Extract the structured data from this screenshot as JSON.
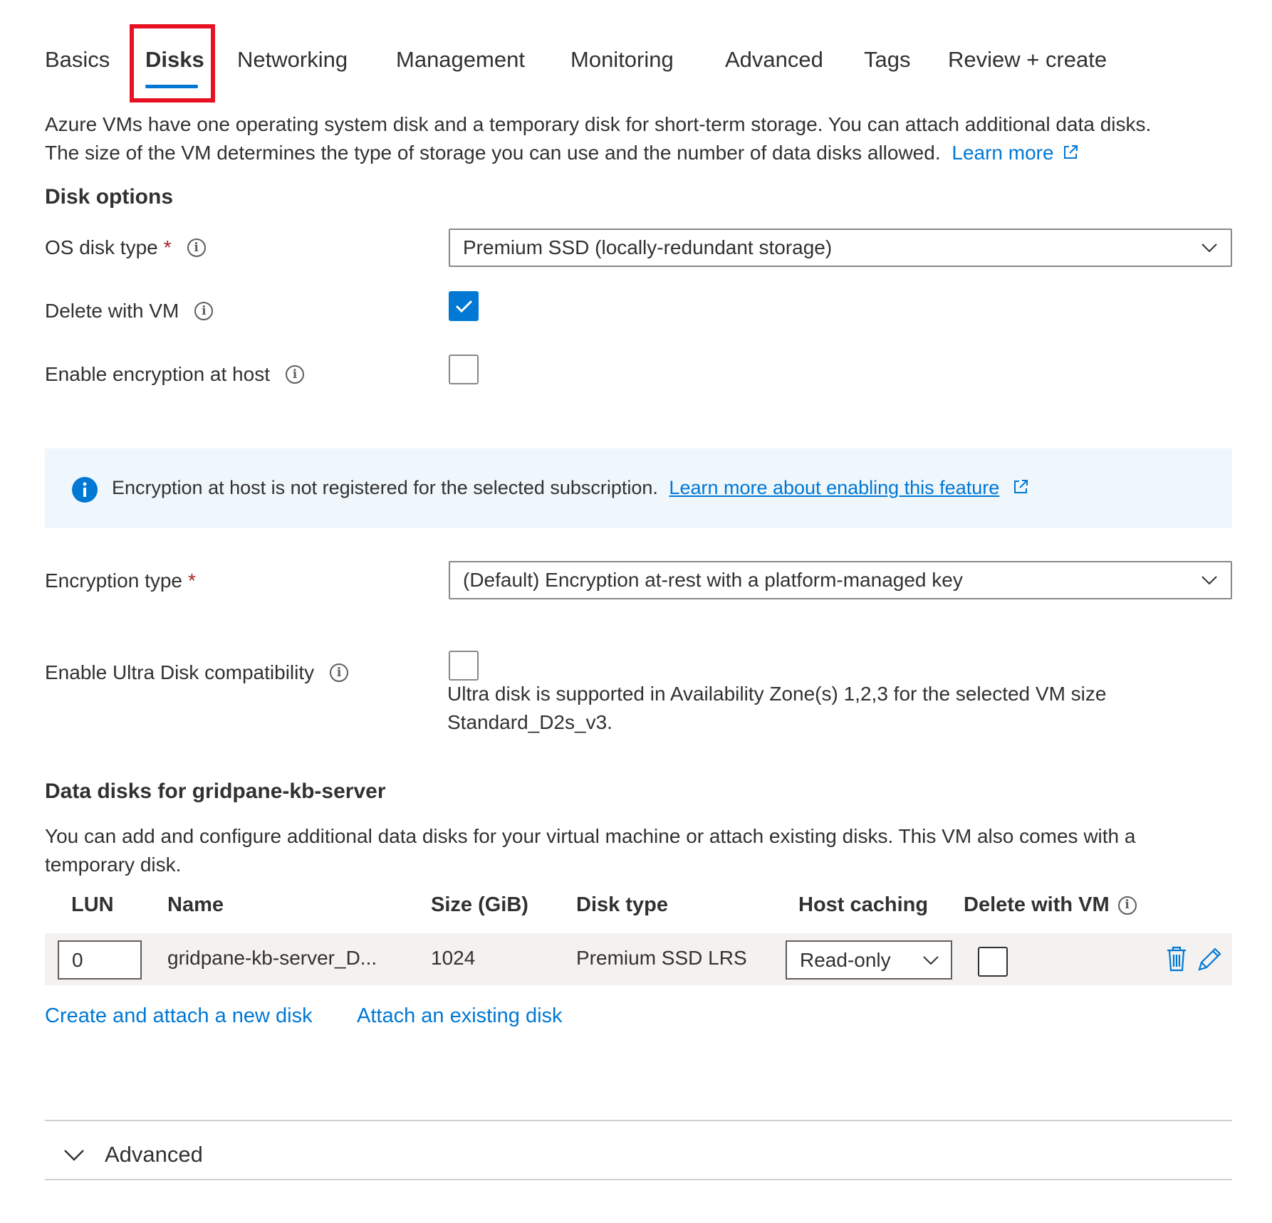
{
  "tabs": [
    {
      "label": "Basics"
    },
    {
      "label": "Disks",
      "active": true
    },
    {
      "label": "Networking"
    },
    {
      "label": "Management"
    },
    {
      "label": "Monitoring"
    },
    {
      "label": "Advanced"
    },
    {
      "label": "Tags"
    },
    {
      "label": "Review + create"
    }
  ],
  "intro": {
    "line1": "Azure VMs have one operating system disk and a temporary disk for short-term storage. You can attach additional data disks.",
    "line2": "The size of the VM determines the type of storage you can use and the number of data disks allowed.",
    "learn_more": "Learn more"
  },
  "disk_options": {
    "title": "Disk options",
    "os_disk_type": {
      "label": "OS disk type",
      "required": "*",
      "value": "Premium SSD (locally-redundant storage)"
    },
    "delete_with_vm": {
      "label": "Delete with VM",
      "checked": true
    },
    "encryption_at_host": {
      "label": "Enable encryption at host",
      "checked": false
    }
  },
  "banner": {
    "text": "Encryption at host is not registered for the selected subscription.",
    "link": "Learn more about enabling this feature"
  },
  "encryption_type": {
    "label": "Encryption type",
    "required": "*",
    "value": "(Default) Encryption at-rest with a platform-managed key"
  },
  "ultra_disk": {
    "label": "Enable Ultra Disk compatibility",
    "checked": false,
    "note_line1": "Ultra disk is supported in Availability Zone(s) 1,2,3 for the selected VM size",
    "note_line2": "Standard_D2s_v3."
  },
  "data_disks": {
    "title": "Data disks for gridpane-kb-server",
    "desc_line1": "You can add and configure additional data disks for your virtual machine or attach existing disks. This VM also comes with a",
    "desc_line2": "temporary disk.",
    "columns": {
      "lun": "LUN",
      "name": "Name",
      "size": "Size (GiB)",
      "disk_type": "Disk type",
      "host_caching": "Host caching",
      "delete_with_vm": "Delete with VM"
    },
    "rows": [
      {
        "lun": "0",
        "name": "gridpane-kb-server_D...",
        "size": "1024",
        "disk_type": "Premium SSD LRS",
        "host_caching": "Read-only",
        "delete_with_vm": false
      }
    ],
    "create_link": "Create and attach a new disk",
    "attach_link": "Attach an existing disk"
  },
  "advanced": {
    "label": "Advanced"
  },
  "colors": {
    "accent": "#0078d4",
    "highlight": "#e81123",
    "required": "#a4262c",
    "banner_bg": "#eff6fc"
  }
}
